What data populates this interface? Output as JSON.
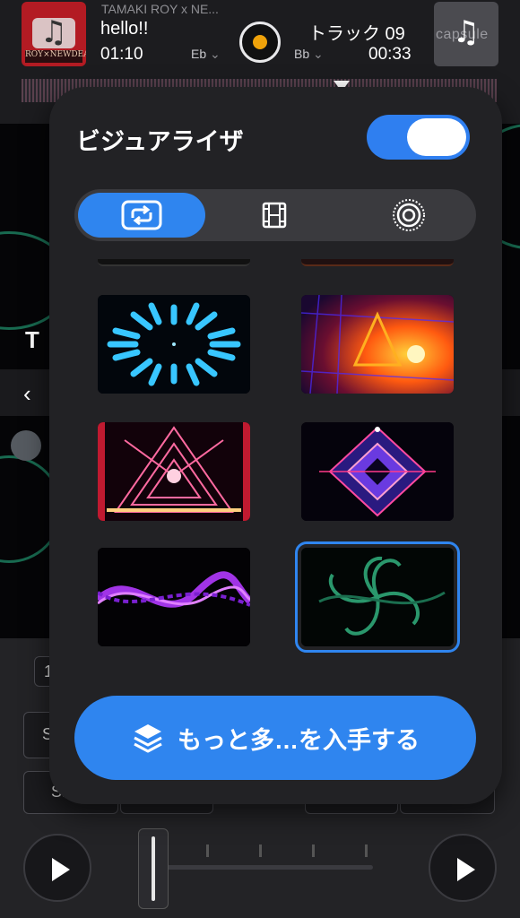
{
  "deck_left": {
    "artist": "TAMAKI ROY x NE...",
    "title": "hello!!",
    "time": "01:10",
    "key": "Eb",
    "artwork_text": "ROY×NEWDEAL",
    "artwork_icon": "music-note-icon"
  },
  "deck_right": {
    "title": "トラック 09",
    "time": "00:33",
    "key": "Bb",
    "artwork_text": "capsule",
    "artwork_icon": "music-note-icon"
  },
  "background": {
    "side_letter": "T",
    "button_1": "S",
    "button_2": "SE",
    "button_3": "1"
  },
  "popover": {
    "title": "ビジュアライザ",
    "toggle_on": true,
    "segments": [
      {
        "icon": "loop-icon",
        "active": true
      },
      {
        "icon": "film-icon",
        "active": false
      },
      {
        "icon": "radial-circles-icon",
        "active": false
      }
    ],
    "visualizers": [
      {
        "name": "cyan-burst",
        "selected": false
      },
      {
        "name": "fire-triangle",
        "selected": false
      },
      {
        "name": "neon-tunnel",
        "selected": false
      },
      {
        "name": "purple-diamond",
        "selected": false
      },
      {
        "name": "purple-wave",
        "selected": false
      },
      {
        "name": "green-flower",
        "selected": true
      }
    ],
    "cta_label": "もっと多…を入手する",
    "cta_icon": "layers-icon"
  },
  "colors": {
    "accent": "#2f85ef",
    "popover_bg": "#222225",
    "segment_bg": "#3a3a3e"
  }
}
